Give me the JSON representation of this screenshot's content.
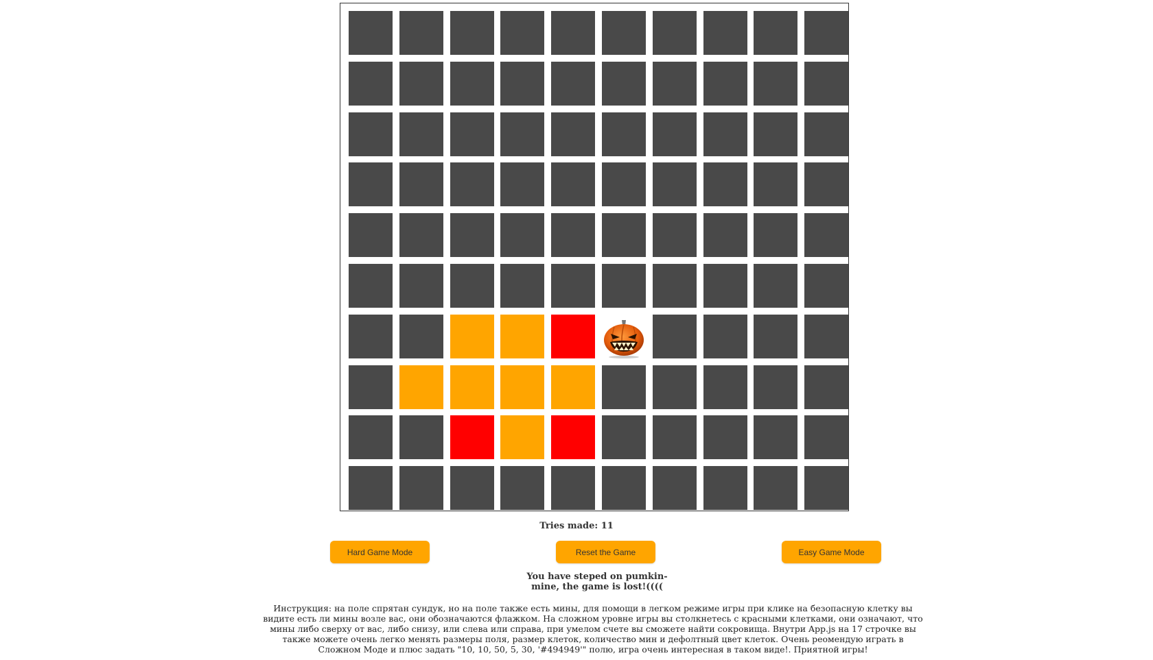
{
  "board": {
    "rows": 10,
    "cols": 10,
    "colors": {
      "dark": "#494949",
      "orange": "#ffa500",
      "red": "#ff0000"
    },
    "cells": [
      [
        "dark",
        "dark",
        "dark",
        "dark",
        "dark",
        "dark",
        "dark",
        "dark",
        "dark",
        "dark"
      ],
      [
        "dark",
        "dark",
        "dark",
        "dark",
        "dark",
        "dark",
        "dark",
        "dark",
        "dark",
        "dark"
      ],
      [
        "dark",
        "dark",
        "dark",
        "dark",
        "dark",
        "dark",
        "dark",
        "dark",
        "dark",
        "dark"
      ],
      [
        "dark",
        "dark",
        "dark",
        "dark",
        "dark",
        "dark",
        "dark",
        "dark",
        "dark",
        "dark"
      ],
      [
        "dark",
        "dark",
        "dark",
        "dark",
        "dark",
        "dark",
        "dark",
        "dark",
        "dark",
        "dark"
      ],
      [
        "dark",
        "dark",
        "dark",
        "dark",
        "dark",
        "dark",
        "dark",
        "dark",
        "dark",
        "dark"
      ],
      [
        "dark",
        "dark",
        "orange",
        "orange",
        "red",
        "pumpkin",
        "dark",
        "dark",
        "dark",
        "dark"
      ],
      [
        "dark",
        "orange",
        "orange",
        "orange",
        "orange",
        "dark",
        "dark",
        "dark",
        "dark",
        "dark"
      ],
      [
        "dark",
        "dark",
        "red",
        "orange",
        "red",
        "dark",
        "dark",
        "dark",
        "dark",
        "dark"
      ],
      [
        "dark",
        "dark",
        "dark",
        "dark",
        "dark",
        "dark",
        "dark",
        "dark",
        "dark",
        "dark"
      ]
    ],
    "mine_icon": "pumpkin-icon"
  },
  "tries": {
    "text": "Tries made: 11"
  },
  "buttons": {
    "hard": "Hard Game Mode",
    "reset": "Reset the Game",
    "easy": "Easy Game Mode",
    "color": "#ffa500"
  },
  "status": {
    "message": "You have steped on pumkin-mine, the game is lost!(((("
  },
  "instructions": {
    "text": "Инструкция: на поле спрятан сундук, но на поле также есть мины, для помощи в легком режиме игры при клике на безопасную клетку вы видите есть ли мины возле вас, они обозначаются флажком. На сложном уровне игры вы столкнетесь с красными клетками, они означают, что мины либо сверху от вас, либо снизу, или слева или справа, при умелом счете вы сможете найти сокровища. Внутри App.js на 17 строчке вы также можете очень легко менять размеры поля, размер клеток, количество мин и дефолтный цвет клеток. Очень реомендую играть в Сложном Моде и плюс задать \"10, 10, 50, 5, 30, '#494949'\" полю, игра очень интересная в таком виде!. Приятной игры!"
  }
}
